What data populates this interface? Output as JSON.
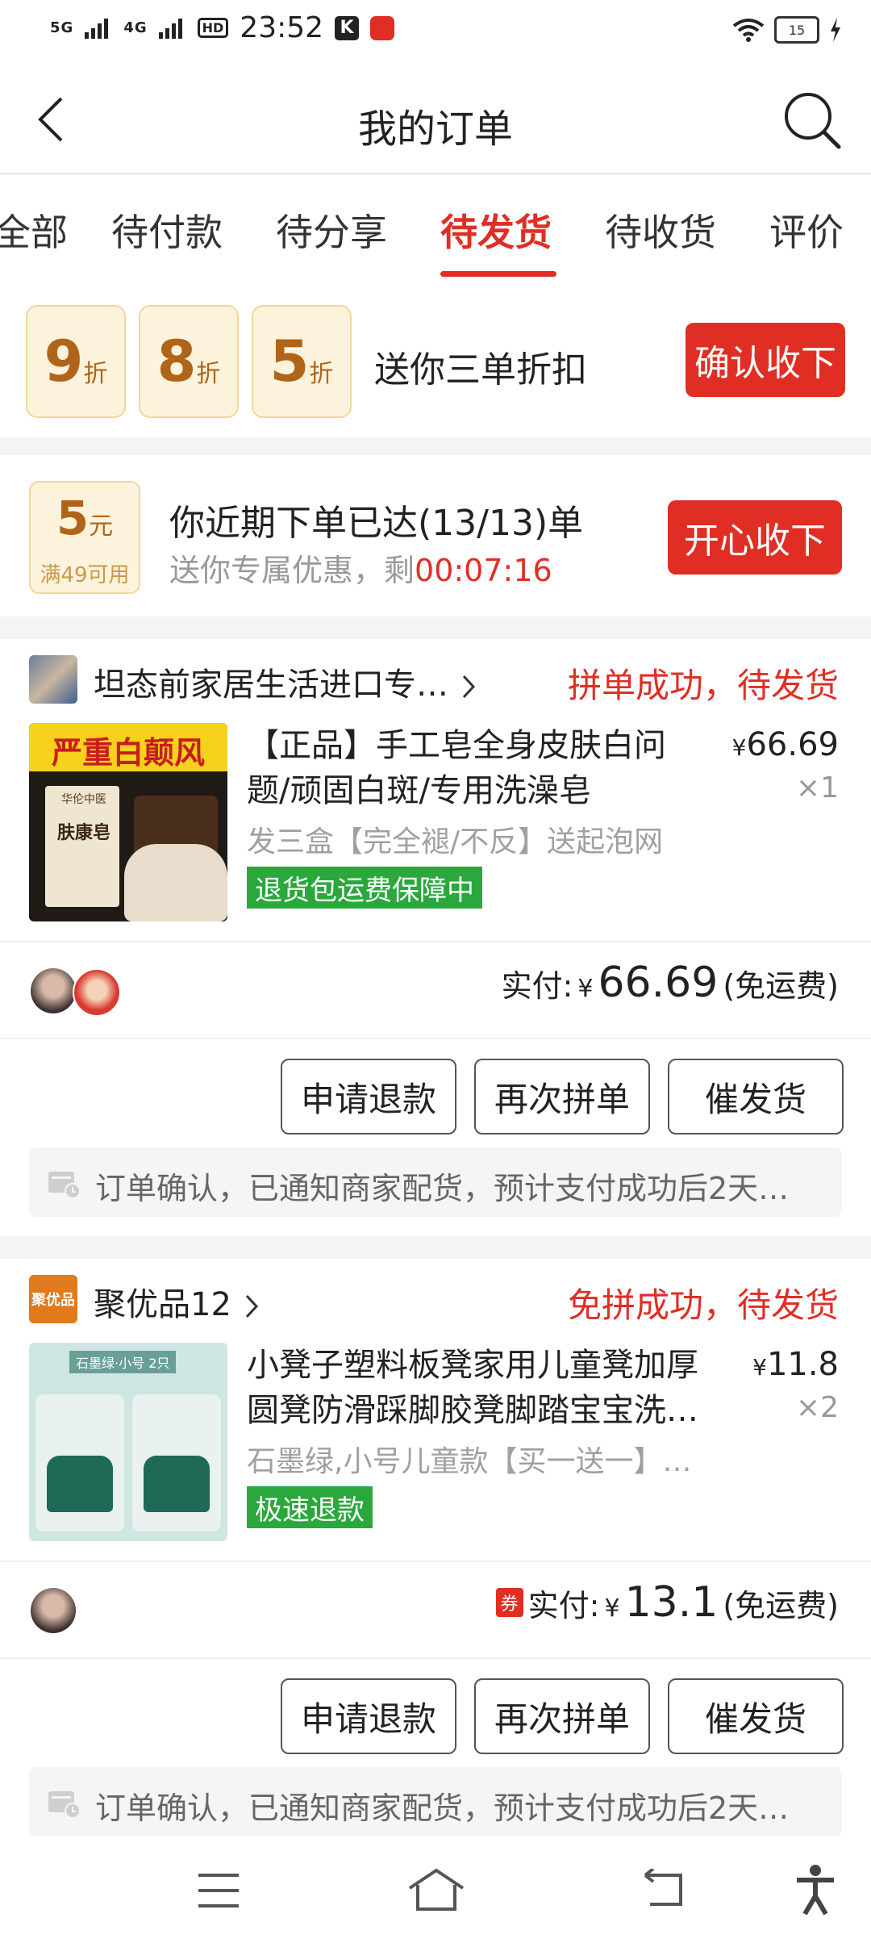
{
  "status_bar": {
    "signal1": "5G",
    "signal2": "4G",
    "hd": "HD",
    "time": "23:52",
    "k_icon": "K",
    "battery": "15"
  },
  "header": {
    "title": "我的订单"
  },
  "tabs": [
    "全部",
    "待付款",
    "待分享",
    "待发货",
    "待收货",
    "评价"
  ],
  "active_tab": "待发货",
  "discount_banner": {
    "cards": [
      {
        "num": "9",
        "unit": "折"
      },
      {
        "num": "8",
        "unit": "折"
      },
      {
        "num": "5",
        "unit": "折"
      }
    ],
    "text": "送你三单折扣",
    "button": "确认收下"
  },
  "promo_banner": {
    "coupon_amount": "5",
    "coupon_unit": "元",
    "coupon_condition": "满49可用",
    "title": "你近期下单已达(13/13)单",
    "subtitle": "送你专属优惠，剩",
    "timer": "00:07:16",
    "button": "开心收下"
  },
  "orders": [
    {
      "shop_name": "坦态前家居生活进口专…",
      "status": "拼单成功，待发货",
      "product_title": "【正品】手工皂全身皮肤白问题/顽固白斑/专用洗澡皂",
      "spec": "发三盒【完全褪/不反】送起泡网",
      "tag": "退货包运费保障中",
      "price_symbol": "¥",
      "price": "66.69",
      "quantity": "×1",
      "paid_label": "实付:",
      "paid_amount": "66.69",
      "shipping": "(免运费)",
      "coupon_badge": "",
      "img_text": "严重白颠风",
      "img_brand": "华伦中医",
      "img_box": "肤康皂",
      "buttons": [
        "申请退款",
        "再次拼单",
        "催发货"
      ],
      "notice": "订单确认，已通知商家配货，预计支付成功后2天…"
    },
    {
      "shop_name": "聚优品12",
      "shop_logo_text": "聚优品",
      "status": "免拼成功，待发货",
      "product_title": "小凳子塑料板凳家用儿童凳加厚圆凳防滑踩脚胶凳脚踏宝宝洗…",
      "spec": "石墨绿,小号儿童款【买一送一】…",
      "tag": "极速退款",
      "price_symbol": "¥",
      "price": "11.8",
      "quantity": "×2",
      "paid_label": "实付:",
      "paid_amount": "13.1",
      "shipping": "(免运费)",
      "coupon_badge": "券",
      "img_label": "石墨绿·小号",
      "img_count": "2只",
      "buttons": [
        "申请退款",
        "再次拼单",
        "催发货"
      ],
      "notice": "订单确认，已通知商家配货，预计支付成功后2天…"
    }
  ],
  "colors": {
    "accent": "#e02e24",
    "green_tag": "#2aa83c",
    "coupon_text": "#b0641a"
  }
}
